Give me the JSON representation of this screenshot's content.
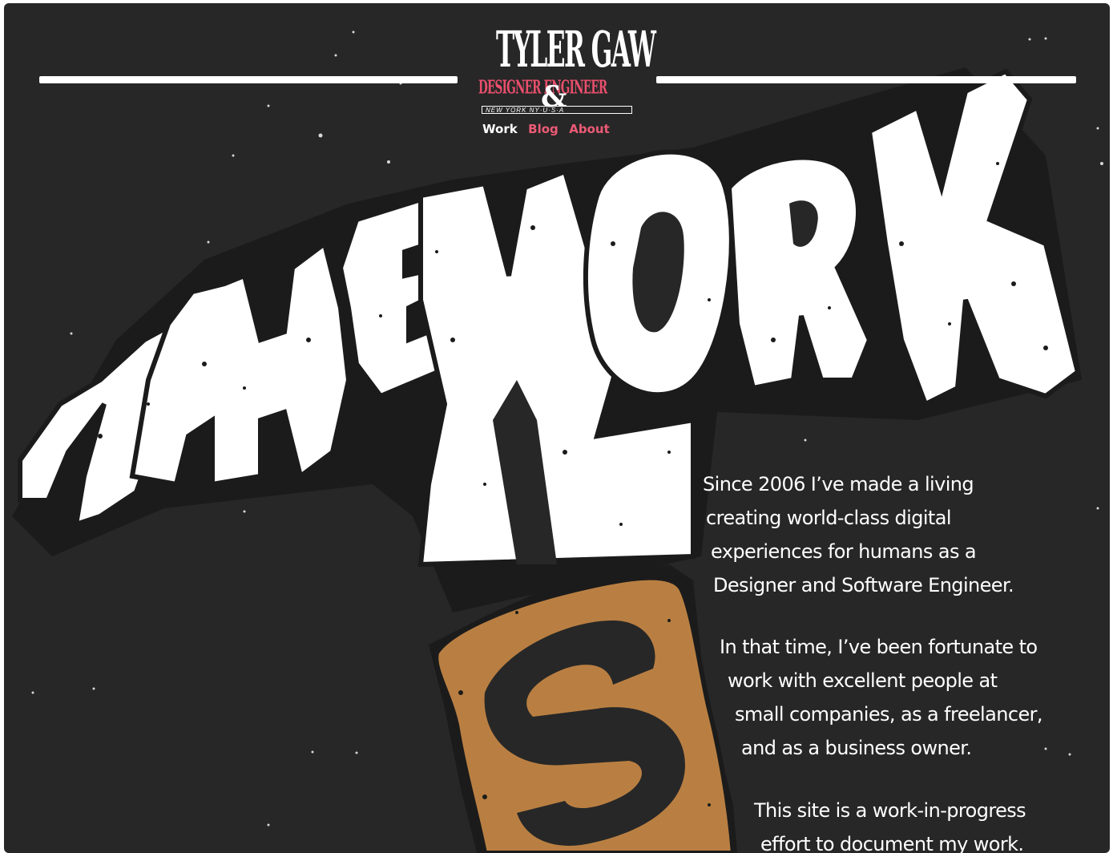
{
  "logo": {
    "name": "TYLER GAW",
    "role": "DESIGNER ENGINEER",
    "ampersand": "&",
    "location": "NEW YORK  NY·U·S·A"
  },
  "nav": {
    "items": [
      {
        "label": "Work",
        "current": true
      },
      {
        "label": "Blog",
        "current": false
      },
      {
        "label": "About",
        "current": false
      }
    ]
  },
  "hero": {
    "title": "THE WORK",
    "suffix": "S"
  },
  "intro": {
    "paragraphs": [
      [
        "Since 2006 I’ve made a living",
        "creating world-class digital",
        "experiences for humans as a",
        "Designer and Software Engineer."
      ],
      [
        "In that time, I’ve been fortunate to",
        "work with excellent people at",
        "small companies, as a freelancer,",
        "and as a business owner."
      ],
      [
        "This site is a work-in-progress",
        "effort to document my work."
      ]
    ]
  },
  "colors": {
    "background": "#272727",
    "ink": "#ffffff",
    "accent_pink": "#ee5a75",
    "accent_ochre": "#b97f42"
  }
}
